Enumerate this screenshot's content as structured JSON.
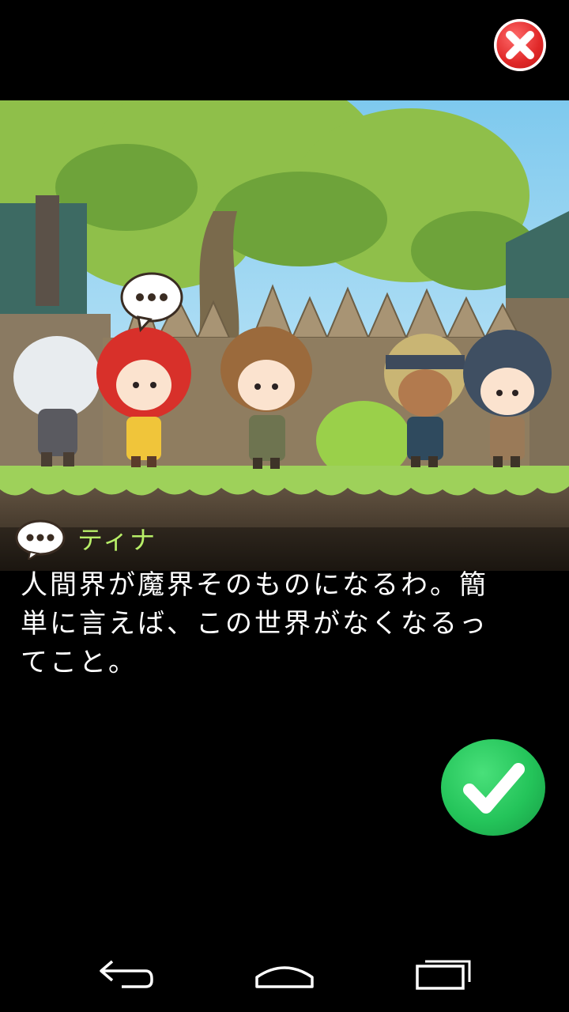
{
  "window": {
    "close_icon": "close-x-icon"
  },
  "scene": {
    "characters": [
      "silver-haired-knight",
      "red-haired-girl",
      "brown-haired-boy",
      "headband-man",
      "blue-haired-girl"
    ],
    "active_speaker_bubble": "ellipsis-speech-bubble-icon"
  },
  "dialogue": {
    "speaker_name": "ティナ",
    "text": "人間界が魔界そのものになるわ。簡\n単に言えば、この世界がなくなるっ\nてこと。"
  },
  "confirm": {
    "icon": "checkmark-icon",
    "color": "#24c45a"
  },
  "navbar": {
    "back": "back-icon",
    "home": "home-icon",
    "recent": "recent-apps-icon"
  }
}
